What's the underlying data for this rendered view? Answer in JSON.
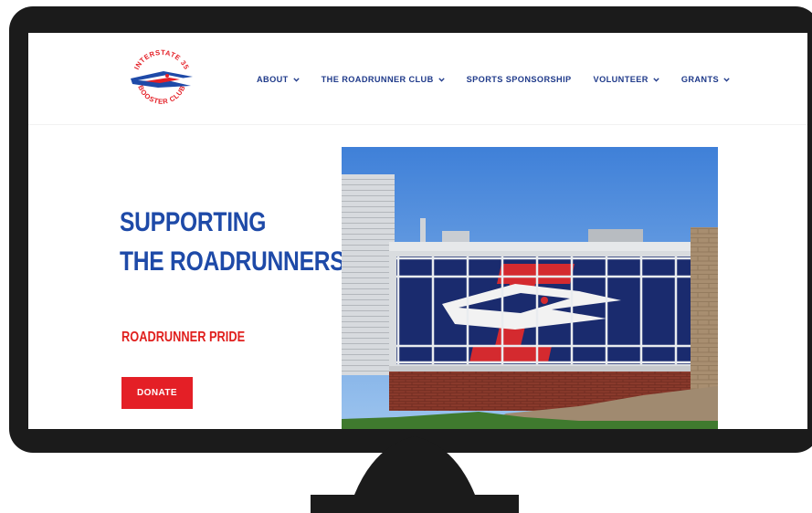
{
  "brand": {
    "logo_text_top": "INTERSTATE 35",
    "logo_text_bottom": "BOOSTER CLUB"
  },
  "nav": {
    "items": [
      {
        "label": "ABOUT",
        "has_dropdown": true
      },
      {
        "label": "THE ROADRUNNER CLUB",
        "has_dropdown": true
      },
      {
        "label": "SPORTS SPONSORSHIP",
        "has_dropdown": false
      },
      {
        "label": "VOLUNTEER",
        "has_dropdown": true
      },
      {
        "label": "GRANTS",
        "has_dropdown": true
      }
    ]
  },
  "hero": {
    "title_line1": "SUPPORTING",
    "title_line2": "THE ROADRUNNERS",
    "tagline": "ROADRUNNER PRIDE",
    "donate_label": "DONATE"
  },
  "colors": {
    "brand_blue": "#1e4aa8",
    "nav_blue": "#1f3a8a",
    "accent_red": "#e41f26",
    "bezel": "#1b1b1b"
  },
  "icons": {
    "dropdown": "chevron-down-icon",
    "logo": "roadrunner-logo-icon"
  }
}
